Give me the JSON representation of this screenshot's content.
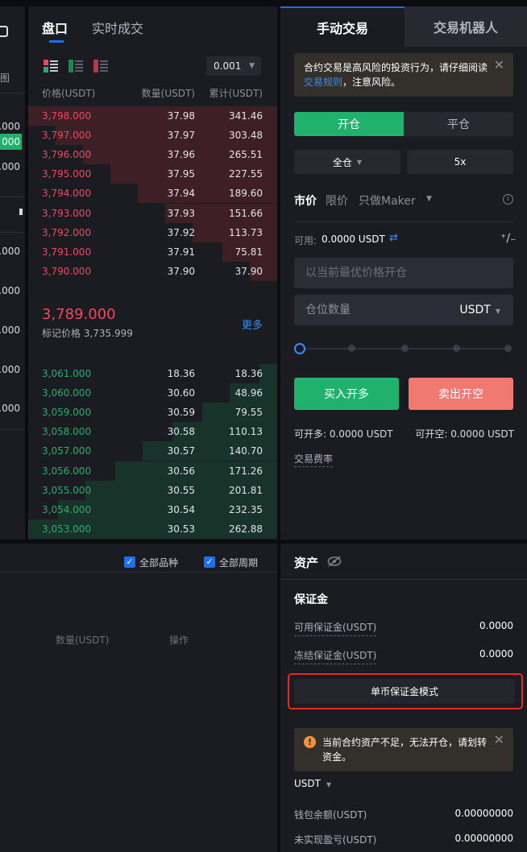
{
  "left_column": {
    "label_top": "图",
    "values": [
      ".000",
      "000",
      ".000",
      ".000",
      ".000",
      ".000",
      ".000",
      ".000"
    ]
  },
  "orderbook": {
    "tabs": [
      "盘口",
      "实时成交"
    ],
    "precision": "0.001",
    "headers": {
      "price": "价格(USDT)",
      "qty": "数量(USDT)",
      "total": "累计(USDT)"
    },
    "asks": [
      {
        "price": "3,798.000",
        "qty": "37.98",
        "total": "341.46",
        "depth": 1.0
      },
      {
        "price": "3,797.000",
        "qty": "37.97",
        "total": "303.48",
        "depth": 0.89
      },
      {
        "price": "3,796.000",
        "qty": "37.96",
        "total": "265.51",
        "depth": 0.78
      },
      {
        "price": "3,795.000",
        "qty": "37.95",
        "total": "227.55",
        "depth": 0.67
      },
      {
        "price": "3,794.000",
        "qty": "37.94",
        "total": "189.60",
        "depth": 0.56
      },
      {
        "price": "3,793.000",
        "qty": "37.93",
        "total": "151.66",
        "depth": 0.45
      },
      {
        "price": "3,792.000",
        "qty": "37.92",
        "total": "113.73",
        "depth": 0.34
      },
      {
        "price": "3,791.000",
        "qty": "37.91",
        "total": "75.81",
        "depth": 0.22
      },
      {
        "price": "3,790.000",
        "qty": "37.90",
        "total": "37.90",
        "depth": 0.11
      }
    ],
    "last_price": "3,789.000",
    "mark_price_label": "标记价格 3,735.999",
    "more": "更多",
    "bids": [
      {
        "price": "3,061.000",
        "qty": "18.36",
        "total": "18.36",
        "depth": 0.07
      },
      {
        "price": "3,060.000",
        "qty": "30.60",
        "total": "48.96",
        "depth": 0.19
      },
      {
        "price": "3,059.000",
        "qty": "30.59",
        "total": "79.55",
        "depth": 0.3
      },
      {
        "price": "3,058.000",
        "qty": "30.58",
        "total": "110.13",
        "depth": 0.42
      },
      {
        "price": "3,057.000",
        "qty": "30.57",
        "total": "140.70",
        "depth": 0.54
      },
      {
        "price": "3,056.000",
        "qty": "30.56",
        "total": "171.26",
        "depth": 0.65
      },
      {
        "price": "3,055.000",
        "qty": "30.55",
        "total": "201.81",
        "depth": 0.77
      },
      {
        "price": "3,054.000",
        "qty": "30.54",
        "total": "232.35",
        "depth": 0.88
      },
      {
        "price": "3,053.000",
        "qty": "30.53",
        "total": "262.88",
        "depth": 1.0
      }
    ]
  },
  "trade": {
    "tabs": [
      "手动交易",
      "交易机器人"
    ],
    "notice_prefix": "合约交易是高风险的投资行为，请仔细阅读",
    "notice_link": "交易规则",
    "notice_suffix": "，注意风险。",
    "open_tab": "开仓",
    "close_tab": "平仓",
    "margin_mode": "全仓",
    "leverage": "5x",
    "order_types": [
      "市价",
      "限价",
      "只做Maker"
    ],
    "available_label": "可用:",
    "available_value": "0.0000 USDT",
    "price_placeholder": "以当前最优价格开仓",
    "qty_placeholder": "仓位数量",
    "qty_unit": "USDT",
    "buy": "买入开多",
    "sell": "卖出开空",
    "can_long": "可开多: 0.0000 USDT",
    "can_short": "可开空: 0.0000 USDT",
    "fee_link": "交易费率"
  },
  "orders": {
    "filter_all_symbols": "全部品种",
    "filter_all_periods": "全部周期",
    "col_qty": "数量(USDT)",
    "col_action": "操作"
  },
  "assets": {
    "title": "资产",
    "section": "保证金",
    "available_margin_label": "可用保证金(USDT)",
    "available_margin_value": "0.0000",
    "frozen_margin_label": "冻结保证金(USDT)",
    "frozen_margin_value": "0.0000",
    "mode_button": "单币保证金模式",
    "warning": "当前合约资产不足，无法开仓，请划转资金。",
    "currency": "USDT",
    "wallet_label": "钱包余额(USDT)",
    "wallet_value": "0.00000000",
    "unrealized_label": "未实现盈亏(USDT)",
    "unrealized_value": "0.00000000"
  },
  "colors": {
    "bg": "#0c0d10",
    "panel": "#1a1c22",
    "red": "#f6465d",
    "green": "#20b26c",
    "accent": "#1e6ff0",
    "highlight": "#e02b1e"
  }
}
